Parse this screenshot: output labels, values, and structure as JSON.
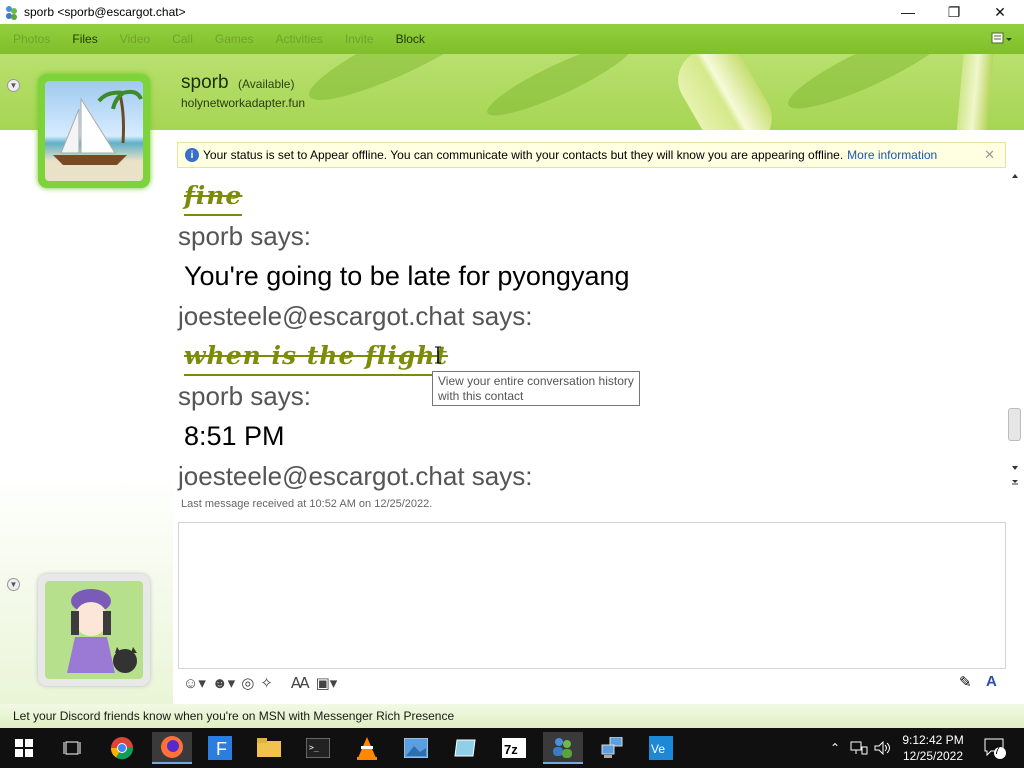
{
  "window": {
    "title": "sporb <sporb@escargot.chat>",
    "minimize": "—",
    "restore": "❐",
    "close": "✕"
  },
  "menu": {
    "items": [
      "Photos",
      "Files",
      "Video",
      "Call",
      "Games",
      "Activities",
      "Invite",
      "Block"
    ],
    "enabled": [
      false,
      true,
      false,
      false,
      false,
      false,
      false,
      true
    ]
  },
  "contact": {
    "name": "sporb",
    "status": "(Available)",
    "psm": "holynetworkadapter.fun"
  },
  "infobar": {
    "text": "Your status is set to Appear offline. You can communicate with your contacts but they will know you are appearing offline.",
    "link": "More information",
    "close": "✕"
  },
  "conversation": {
    "line1": "fine",
    "line2": "sporb says:",
    "line3": "You're going to be late for pyongyang",
    "line4": "joesteele@escargot.chat says:",
    "line5": "when is the flight",
    "line6": "sporb says:",
    "line7": "8:51 PM",
    "line8": "joesteele@escargot.chat says:"
  },
  "last_message": "Last message received at 10:52 AM on 12/25/2022.",
  "tooltip": {
    "line1": "View your entire conversation history",
    "line2": "with this contact"
  },
  "statusbar": "Let your Discord friends know when you're on MSN with Messenger Rich Presence",
  "taskbar": {
    "time": "9:12:42 PM",
    "date": "12/25/2022",
    "notifications": "7"
  },
  "colors": {
    "menubar": "#8cc937",
    "fancy_text": "#7b8c09",
    "link": "#1a56b8"
  }
}
